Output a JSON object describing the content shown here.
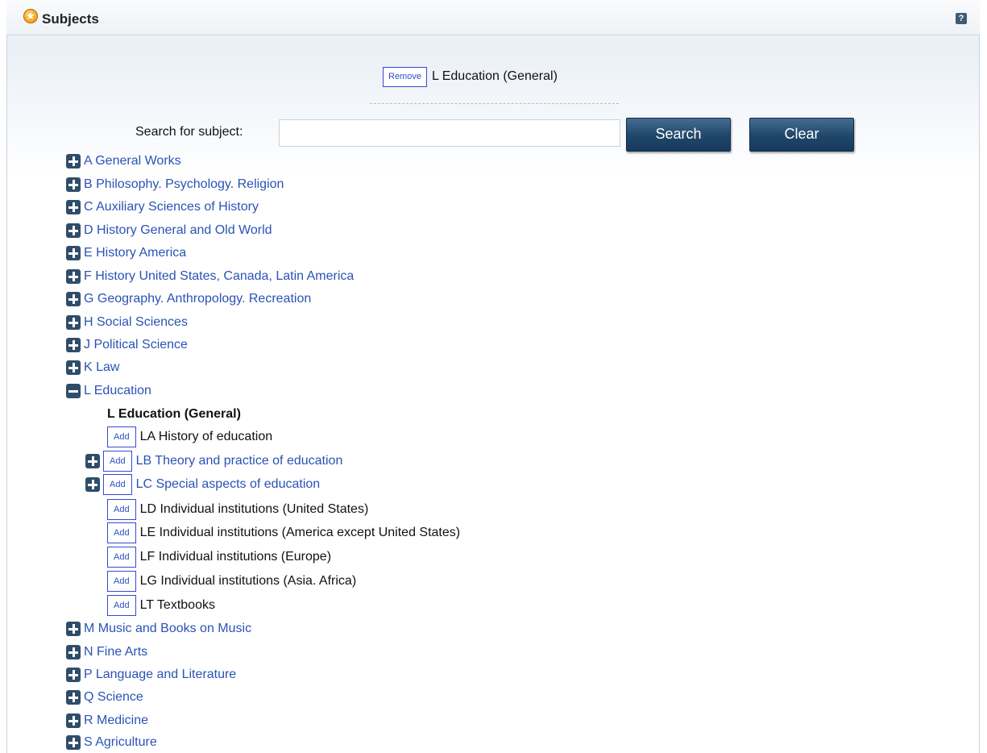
{
  "header": {
    "title": "Subjects",
    "help": "?"
  },
  "selected": {
    "remove_label": "Remove",
    "subject": "L Education (General)"
  },
  "search": {
    "label": "Search for subject:",
    "value": "",
    "search_label": "Search",
    "clear_label": "Clear"
  },
  "tree_top": [
    "A General Works",
    "B Philosophy. Psychology. Religion",
    "C Auxiliary Sciences of History",
    "D History General and Old World",
    "E History America",
    "F History United States, Canada, Latin America",
    "G Geography. Anthropology. Recreation",
    "H Social Sciences",
    "J Political Science",
    "K Law"
  ],
  "expanded": {
    "label": "L Education",
    "general": "L Education (General)",
    "add_label": "Add",
    "children": [
      "LA History of education",
      "LB Theory and practice of education",
      "LC Special aspects of education",
      "LD Individual institutions (United States)",
      "LE Individual institutions (America except United States)",
      "LF Individual institutions (Europe)",
      "LG Individual institutions (Asia. Africa)",
      "LT Textbooks"
    ]
  },
  "tree_bottom": [
    "M Music and Books on Music",
    "N Fine Arts",
    "P Language and Literature",
    "Q Science",
    "R Medicine",
    "S Agriculture"
  ]
}
